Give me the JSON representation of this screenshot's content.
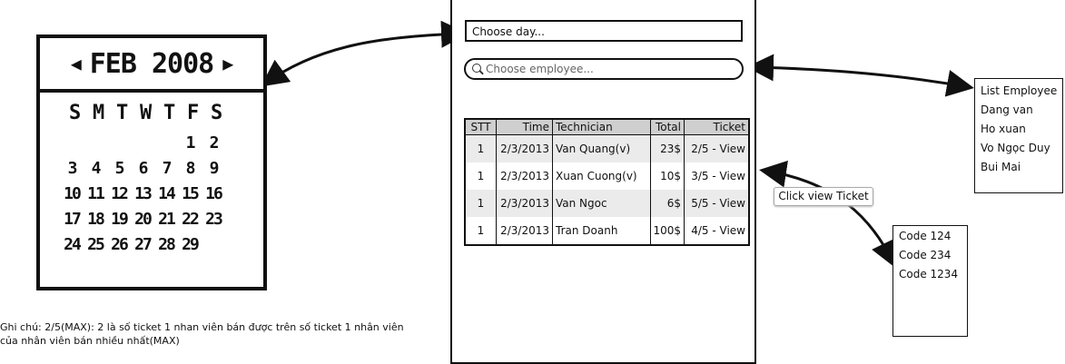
{
  "calendar": {
    "prev_icon": "◀",
    "month_year": "FEB 2008",
    "next_icon": "▶",
    "weekdays": [
      "S",
      "M",
      "T",
      "W",
      "T",
      "F",
      "S"
    ],
    "days": [
      [
        "",
        "",
        "",
        "",
        "",
        "1",
        "2"
      ],
      [
        "3",
        "4",
        "5",
        "6",
        "7",
        "8",
        "9"
      ],
      [
        "10",
        "11",
        "12",
        "13",
        "14",
        "15",
        "16"
      ],
      [
        "17",
        "18",
        "19",
        "20",
        "21",
        "22",
        "23"
      ],
      [
        "24",
        "25",
        "26",
        "27",
        "28",
        "29",
        ""
      ]
    ]
  },
  "note": {
    "line1": "Ghi chú: 2/5(MAX): 2 là số ticket 1 nhan viên bán được trên số ticket 1 nhân viên",
    "line2": " của nhân viên bán nhiều nhất(MAX)"
  },
  "form": {
    "day_placeholder": "Choose day...",
    "employee_placeholder": "Choose employee..."
  },
  "table": {
    "headers": {
      "stt": "STT",
      "time": "Time",
      "technician": "Technician",
      "total": "Total",
      "ticket": "Ticket"
    },
    "rows": [
      {
        "stt": "1",
        "time": "2/3/2013",
        "technician": "Van Quang(v)",
        "total": "23$",
        "ticket": "2/5 - View"
      },
      {
        "stt": "1",
        "time": "2/3/2013",
        "technician": "Xuan Cuong(v)",
        "total": "10$",
        "ticket": "3/5 - View"
      },
      {
        "stt": "1",
        "time": "2/3/2013",
        "technician": "Van Ngoc",
        "total": "6$",
        "ticket": "5/5 - View"
      },
      {
        "stt": "1",
        "time": "2/3/2013",
        "technician": "Tran Doanh",
        "total": "100$",
        "ticket": "4/5 - View"
      }
    ]
  },
  "employee_list": {
    "items": [
      "List Employee",
      "Dang van",
      "Ho xuan",
      "Vo Ngọc Duy",
      "Bui Mai"
    ]
  },
  "tooltip": {
    "text": "Click view Ticket"
  },
  "code_list": {
    "items": [
      "Code 124",
      "Code 234",
      "Code 1234"
    ]
  }
}
